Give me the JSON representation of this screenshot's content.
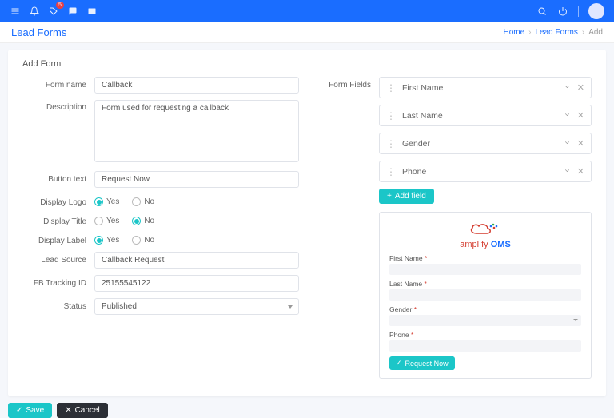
{
  "nav": {
    "notification_badge": "5"
  },
  "header": {
    "title": "Lead Forms",
    "breadcrumb": {
      "home": "Home",
      "section": "Lead Forms",
      "current": "Add"
    }
  },
  "card": {
    "title": "Add Form",
    "labels": {
      "form_name": "Form name",
      "description": "Description",
      "button_text": "Button text",
      "display_logo": "Display Logo",
      "display_title": "Display Title",
      "display_label": "Display Label",
      "lead_source": "Lead Source",
      "fb_tracking": "FB Tracking ID",
      "status": "Status",
      "form_fields": "Form Fields"
    },
    "values": {
      "form_name": "Callback",
      "description": "Form used for requesting a callback",
      "button_text": "Request Now",
      "lead_source": "Callback Request",
      "fb_tracking": "25155545122",
      "status": "Published"
    },
    "radio": {
      "yes": "Yes",
      "no": "No"
    },
    "display_logo": "yes",
    "display_title": "no",
    "display_label": "yes",
    "fields": [
      {
        "label": "First Name"
      },
      {
        "label": "Last Name"
      },
      {
        "label": "Gender"
      },
      {
        "label": "Phone"
      }
    ],
    "add_field": "Add field"
  },
  "preview": {
    "brand_a": "amplıfy ",
    "brand_b": "OMS",
    "fields": [
      {
        "label": "First Name",
        "type": "text"
      },
      {
        "label": "Last Name",
        "type": "text"
      },
      {
        "label": "Gender",
        "type": "select"
      },
      {
        "label": "Phone",
        "type": "text"
      }
    ],
    "button": "Request Now"
  },
  "footer": {
    "save": "Save",
    "cancel": "Cancel"
  }
}
